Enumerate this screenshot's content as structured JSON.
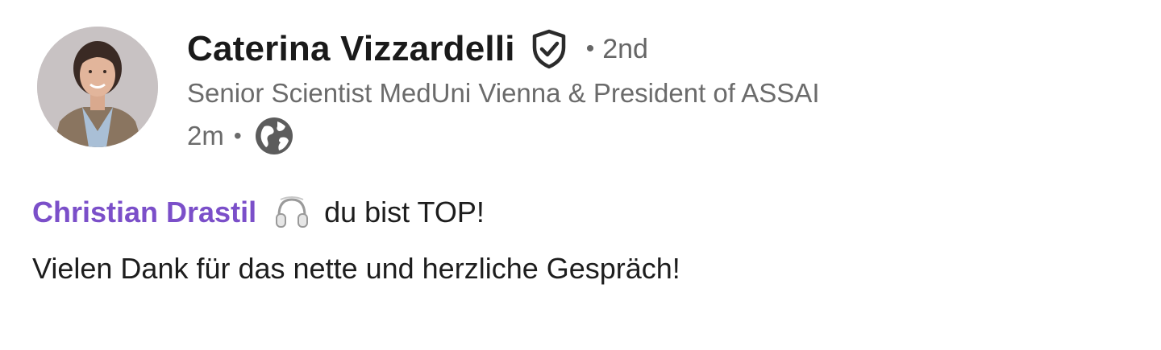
{
  "post": {
    "author": {
      "name": "Caterina Vizzardelli",
      "degree_separator": "•",
      "degree": "2nd",
      "headline": "Senior Scientist MedUni Vienna & President of ASSAI",
      "verified_icon": "shield-check-icon",
      "avatar_icon": "avatar"
    },
    "meta": {
      "time": "2m",
      "separator": "•",
      "visibility_icon": "globe-icon"
    },
    "comment": {
      "mention": "Christian Drastil",
      "emoji_icon": "headphones-icon",
      "line1_text": "du bist TOP!",
      "line2_text": "Vielen Dank für das nette und herzliche Gespräch!"
    }
  },
  "colors": {
    "mention": "#7b4fc9",
    "secondary_text": "#6b6b6b",
    "primary_text": "#1d1d1d"
  }
}
